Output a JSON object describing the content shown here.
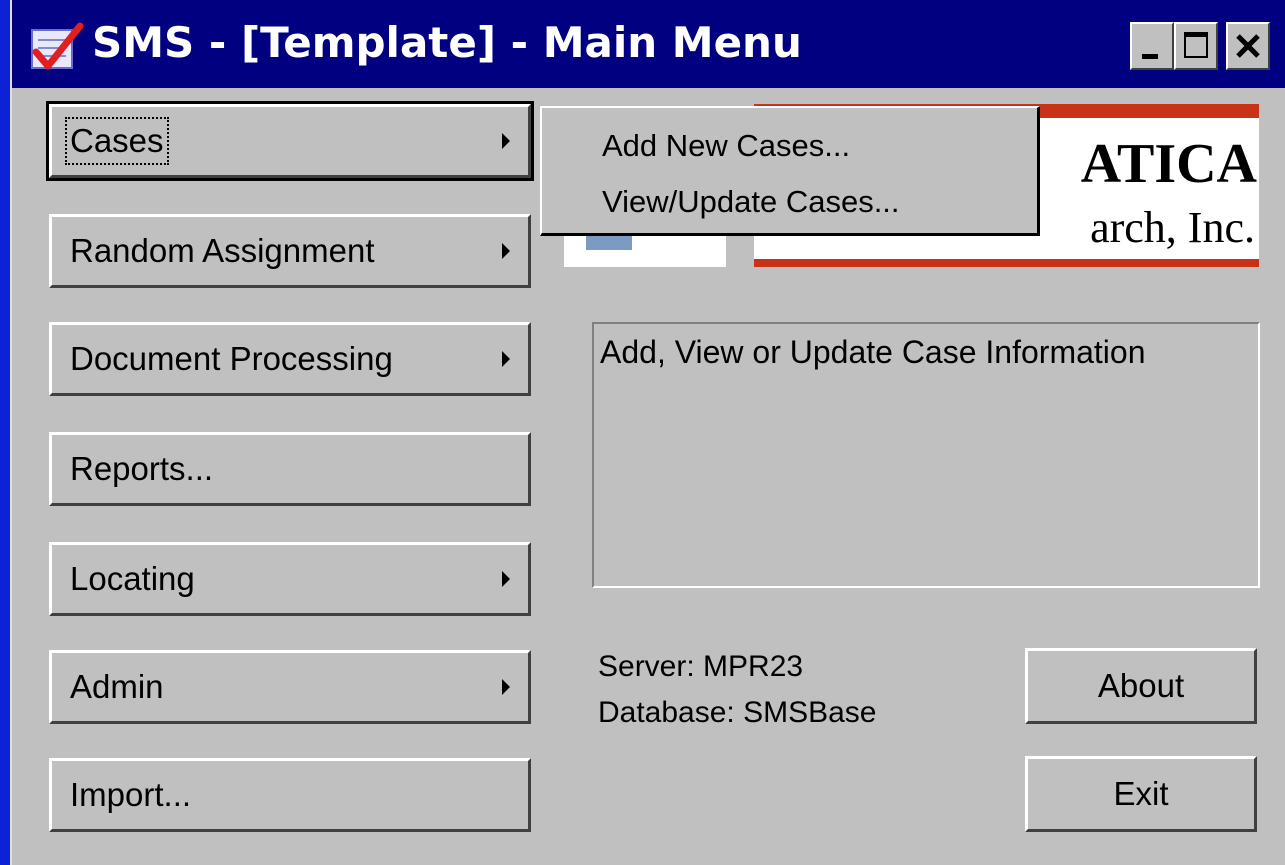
{
  "window": {
    "title": "SMS - [Template] - Main Menu",
    "controls": [
      "minimize",
      "maximize",
      "close"
    ]
  },
  "menu": [
    {
      "label": "Cases",
      "has_submenu": true,
      "active": true
    },
    {
      "label": "Random Assignment",
      "has_submenu": true
    },
    {
      "label": "Document Processing",
      "has_submenu": true
    },
    {
      "label": "Reports...",
      "has_submenu": false
    },
    {
      "label": "Locating",
      "has_submenu": true
    },
    {
      "label": "Admin",
      "has_submenu": true
    },
    {
      "label": "Import...",
      "has_submenu": false
    }
  ],
  "popup": {
    "items": [
      "Add New Cases...",
      "View/Update Cases..."
    ]
  },
  "logo": {
    "line1": "ATICA",
    "line2": "arch, Inc.",
    "accent_color": "#c83216"
  },
  "description": "Add, View or Update Case Information",
  "server": {
    "server_line": "Server: MPR23",
    "database_line": "Database: SMSBase"
  },
  "buttons": {
    "about": "About",
    "exit": "Exit"
  },
  "colors": {
    "desktop": "#0d22d6",
    "titlebar": "#000080",
    "face": "#c0c0c0"
  }
}
